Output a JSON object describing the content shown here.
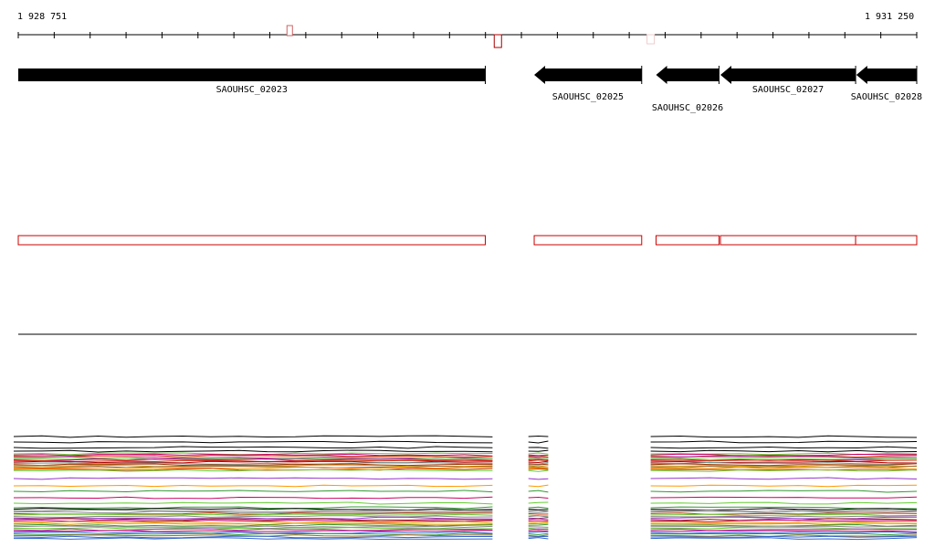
{
  "range": {
    "start_label": "1 928 751",
    "end_label": "1 931 250",
    "start": 1928751,
    "end": 1931250
  },
  "colors": {
    "gene": "#000000",
    "feature_box": "#cc0000",
    "axis": "#000000"
  },
  "genes": [
    {
      "id": "SAOUHSC_02023",
      "start": 1928751,
      "end": 1930050,
      "strand": "+",
      "label_row": 0
    },
    {
      "id": "SAOUHSC_02025",
      "start": 1930186,
      "end": 1930485,
      "strand": "-",
      "label_row": 1
    },
    {
      "id": "SAOUHSC_02026",
      "start": 1930525,
      "end": 1930700,
      "strand": "-",
      "label_row": 2
    },
    {
      "id": "SAOUHSC_02027",
      "start": 1930704,
      "end": 1931080,
      "strand": "-",
      "label_row": 0
    },
    {
      "id": "SAOUHSC_02028",
      "start": 1931082,
      "end": 1931250,
      "strand": "-",
      "label_row": 1
    }
  ],
  "markers": [
    {
      "pos": 1929506,
      "kind": "top-small"
    },
    {
      "pos": 1930085,
      "kind": "bottom"
    },
    {
      "pos": 1930510,
      "kind": "bottom-faint"
    }
  ],
  "feature_boxes": [
    {
      "start": 1928751,
      "end": 1930050
    },
    {
      "start": 1930186,
      "end": 1930485
    },
    {
      "start": 1930525,
      "end": 1930700
    },
    {
      "start": 1930704,
      "end": 1931080
    },
    {
      "start": 1931080,
      "end": 1931250
    }
  ],
  "coverage_segments": [
    {
      "start": 1928735,
      "end": 1930070
    },
    {
      "start": 1930170,
      "end": 1930225
    },
    {
      "start": 1930510,
      "end": 1931250
    }
  ],
  "track_palette": [
    "#000000",
    "#cc3300",
    "#339933",
    "#9933cc",
    "#cc9900",
    "#3366cc",
    "#993300",
    "#66cc33",
    "#cc0066",
    "#669999",
    "#ff9900",
    "#333399",
    "#996633",
    "#00aa88",
    "#aa0000",
    "#888888"
  ]
}
